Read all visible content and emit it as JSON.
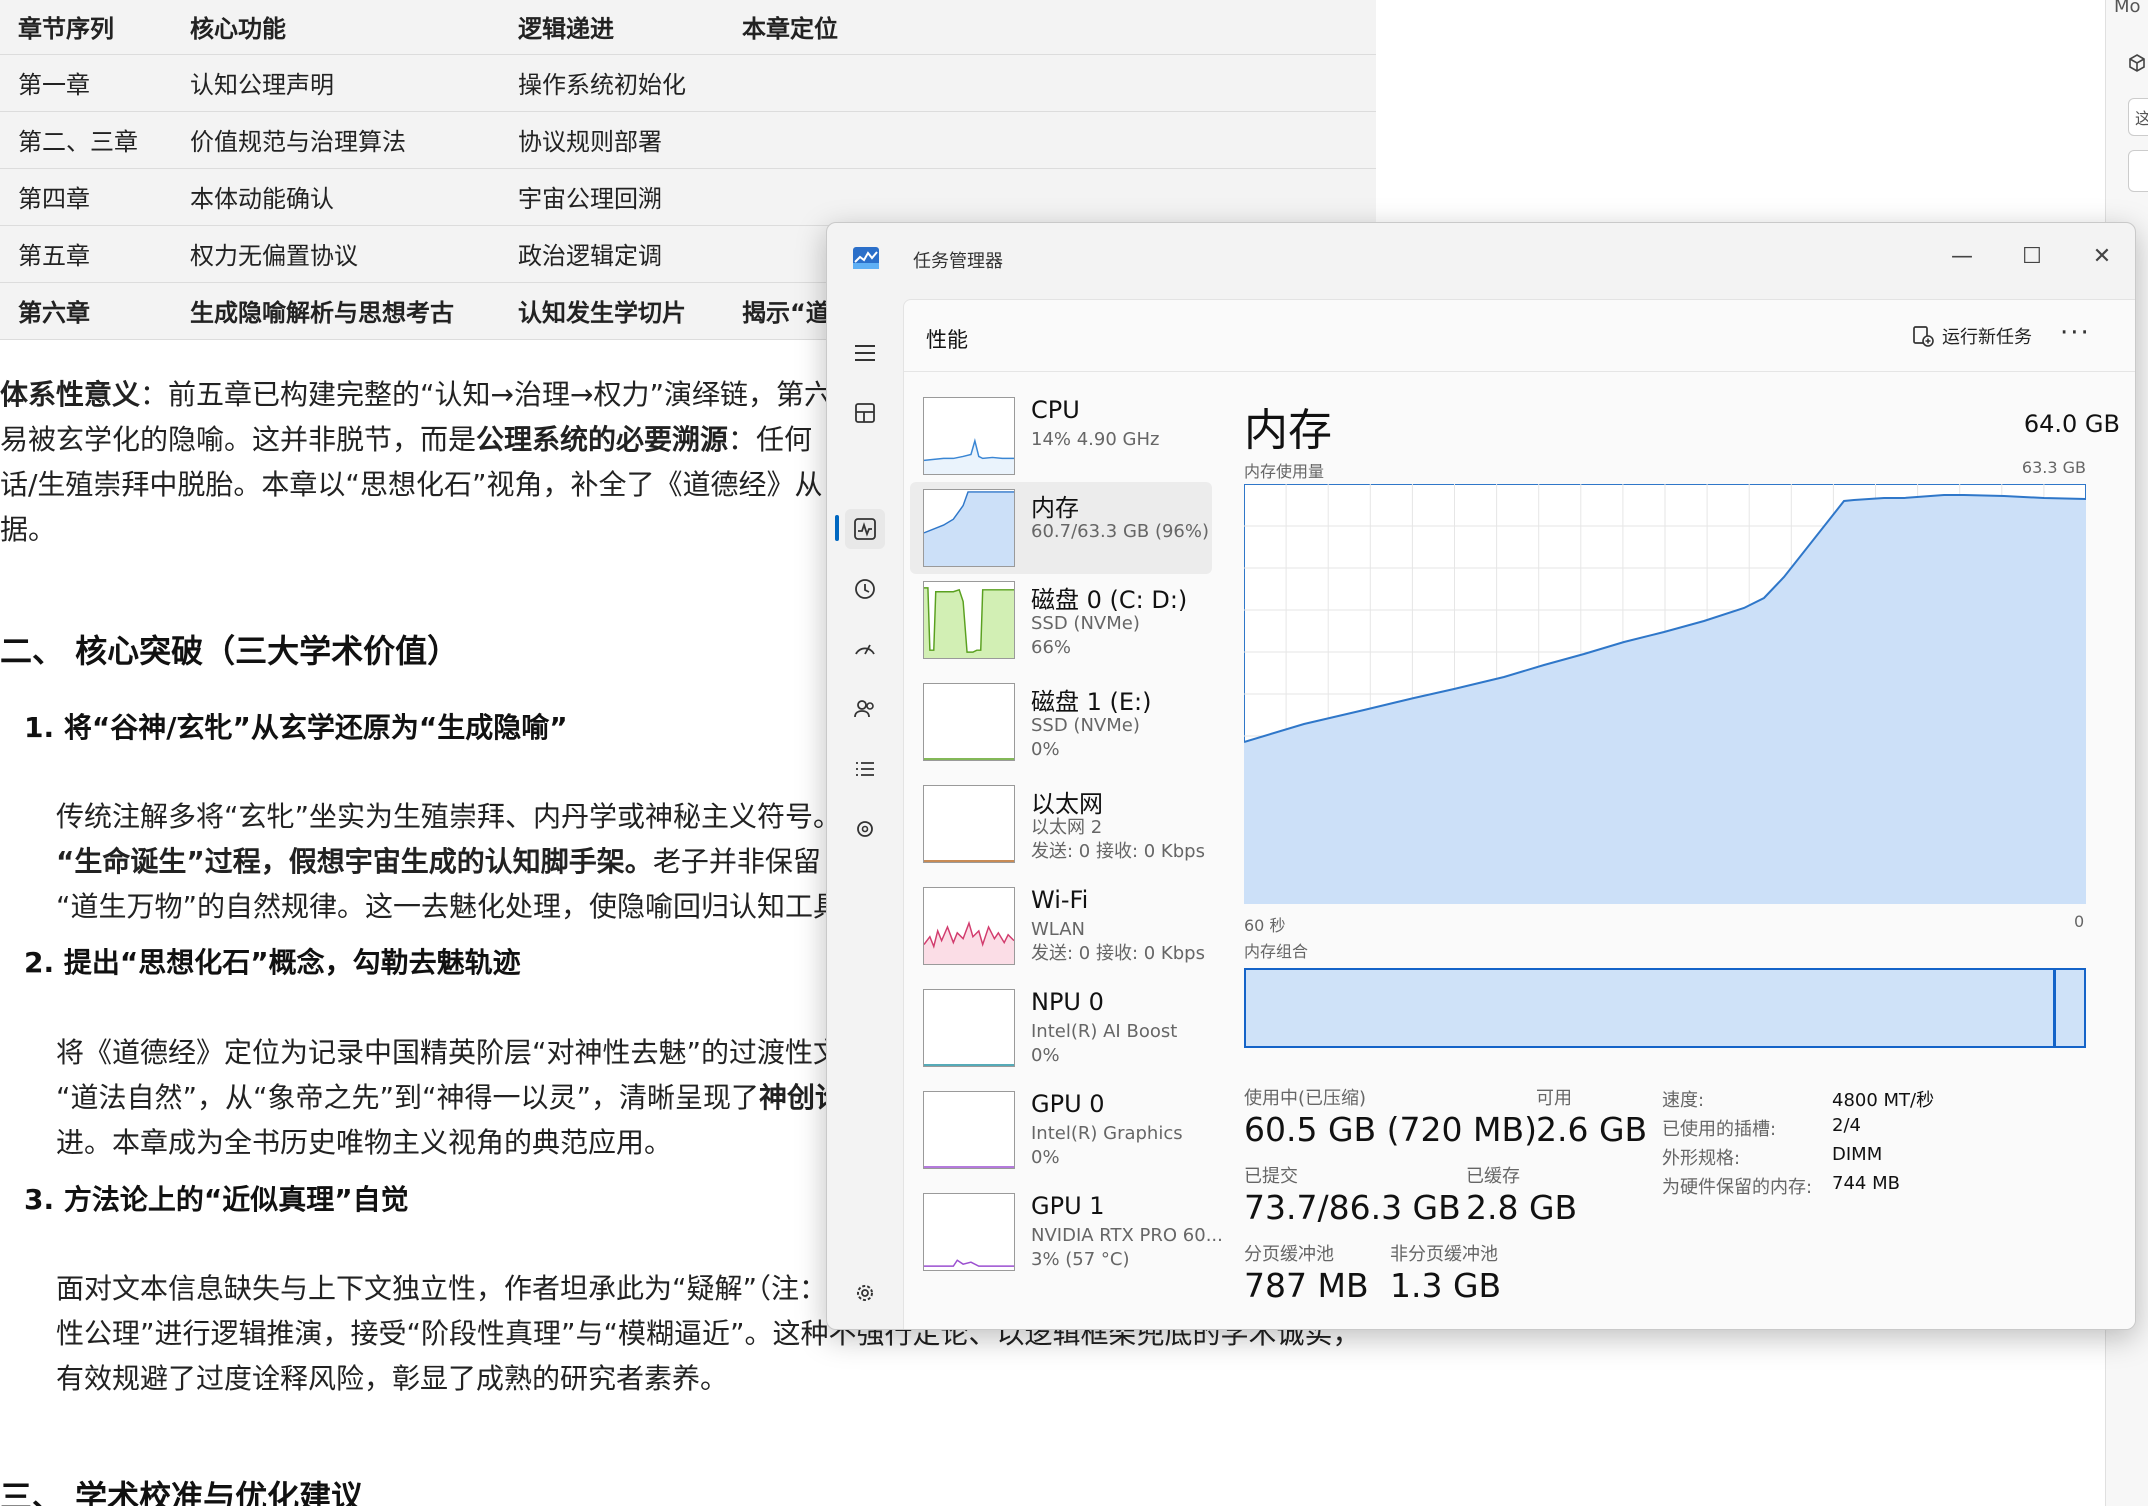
{
  "document": {
    "table": {
      "headers": [
        "章节序列",
        "核心功能",
        "逻辑递进",
        "本章定位"
      ],
      "rows": [
        [
          "第一章",
          "认知公理声明",
          "操作系统初始化",
          ""
        ],
        [
          "第二、三章",
          "价值规范与治理算法",
          "协议规则部署",
          ""
        ],
        [
          "第四章",
          "本体动能确认",
          "宇宙公理回溯",
          ""
        ],
        [
          "第五章",
          "权力无偏置协议",
          "政治逻辑定调",
          ""
        ],
        [
          "第六章",
          "生成隐喻解析与思想考古",
          "认知发生学切片",
          "揭示“道"
        ]
      ]
    },
    "para1": {
      "bold1": "体系性意义",
      "text1": "：前五章已构建完整的“认知→治理→权力”演绎链，第六",
      "line2a": "易被玄学化的隐喻。这并非脱节，而是",
      "line2b": "公理系统的必要溯源",
      "line2c": "：任何",
      "line3": "话/生殖崇拜中脱胎。本章以“思想化石”视角，补全了《道德经》从",
      "line4": "据。"
    },
    "h2_core": "二、 核心突破（三大学术价值）",
    "item1": {
      "title": "1. 将“谷神/玄牝”从玄学还原为“生成隐喻”",
      "line1": "传统注解多将“玄牝”坐实为生殖崇拜、内丹学或神秘主义符号。",
      "line2a": "“生命诞生”过程，假想宇宙生成的认知脚手架。",
      "line2b": "老子并非保留",
      "line3": "“道生万物”的自然规律。这一去魅化处理，使隐喻回归认知工具"
    },
    "item2": {
      "title": "2. 提出“思想化石”概念，勾勒去魅轨迹",
      "line1": "将《道德经》定位为记录中国精英阶层“对神性去魅”的过渡性文",
      "line2a": "“道法自然”，从“象帝之先”到“神得一以灵”，清晰呈现了",
      "line2b": "神创论",
      "line3": "进。本章成为全书历史唯物主义视角的典范应用。"
    },
    "item3": {
      "title": "3. 方法论上的“近似真理”自觉",
      "line1": "面对文本信息缺失与上下文独立性，作者坦承此为“疑解”（注：",
      "line2": "性公理”进行逻辑推演，接受“阶段性真理”与“模糊逼近”。这种不强行定论、以逻辑框架兜底的学术诚实，",
      "line3": "有效规避了过度诠释风险，彰显了成熟的研究者素养。"
    },
    "h3_calib": "三、 学术校准与优化建议"
  },
  "right_strip": [
    "Mo",
    "这"
  ],
  "task_manager": {
    "window_title": "任务管理器",
    "page_title": "性能",
    "run_new_task": "运行新任务",
    "more": "···",
    "resources": [
      {
        "name": "CPU",
        "sub1": "14% 4.90 GHz",
        "sub2": "",
        "sub3": ""
      },
      {
        "name": "内存",
        "sub1": "60.7/63.3 GB (96%)",
        "sub2": "",
        "sub3": ""
      },
      {
        "name": "磁盘 0 (C: D:)",
        "sub1": "SSD (NVMe)",
        "sub2": "66%",
        "sub3": ""
      },
      {
        "name": "磁盘 1 (E:)",
        "sub1": "SSD (NVMe)",
        "sub2": "0%",
        "sub3": ""
      },
      {
        "name": "以太网",
        "sub1": "以太网 2",
        "sub2": "发送: 0 接收: 0 Kbps",
        "sub3": ""
      },
      {
        "name": "Wi-Fi",
        "sub1": "WLAN",
        "sub2": "发送: 0 接收: 0 Kbps",
        "sub3": ""
      },
      {
        "name": "NPU 0",
        "sub1": "Intel(R) AI Boost",
        "sub2": "0%",
        "sub3": ""
      },
      {
        "name": "GPU 0",
        "sub1": "Intel(R) Graphics",
        "sub2": "0%",
        "sub3": ""
      },
      {
        "name": "GPU 1",
        "sub1": "NVIDIA RTX PRO 60...",
        "sub2": "3% (57 °C)",
        "sub3": ""
      }
    ],
    "memory": {
      "title": "内存",
      "total": "64.0 GB",
      "usage_label": "内存使用量",
      "max_label": "63.3 GB",
      "x_left": "60 秒",
      "x_right": "0",
      "composition_label": "内存组合",
      "in_use_label": "使用中(已压缩)",
      "in_use_value": "60.5 GB (720 MB)",
      "available_label": "可用",
      "available_value": "2.6 GB",
      "committed_label": "已提交",
      "committed_value": "73.7/86.3 GB",
      "cached_label": "已缓存",
      "cached_value": "2.8 GB",
      "paged_label": "分页缓冲池",
      "paged_value": "787 MB",
      "nonpaged_label": "非分页缓冲池",
      "nonpaged_value": "1.3 GB",
      "speed_label": "速度:",
      "speed_value": "4800 MT/秒",
      "slots_label": "已使用的插槽:",
      "slots_value": "2/4",
      "form_label": "外形规格:",
      "form_value": "DIMM",
      "reserved_label": "为硬件保留的内存:",
      "reserved_value": "744 MB"
    },
    "colors": {
      "memory_fill": "#cce0f8",
      "memory_line": "#2f77c9",
      "disk_fill": "#d2efb4",
      "disk_line": "#5aa020",
      "wifi_line": "#d23c6e",
      "wifi_fill": "#fbdde6",
      "gpu_line": "#9b4fd0",
      "accent": "#0067c0"
    }
  }
}
